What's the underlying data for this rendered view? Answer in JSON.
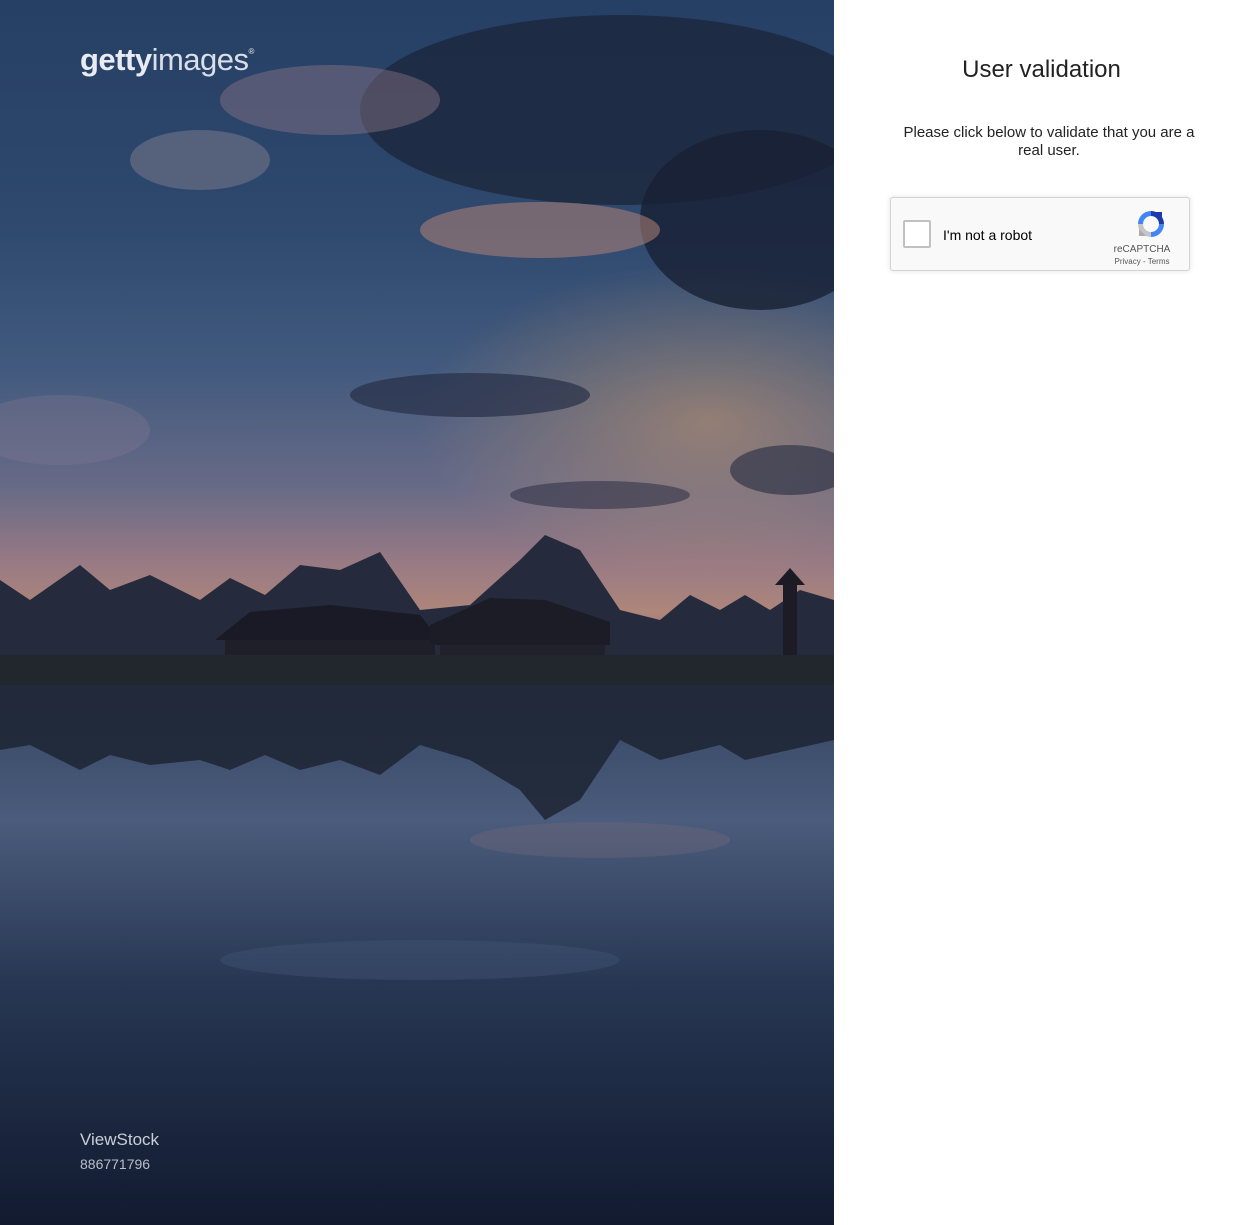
{
  "hero": {
    "logo_bold": "getty",
    "logo_light": "images",
    "logo_mark": "®",
    "artist": "ViewStock",
    "asset_id": "886771796"
  },
  "validation": {
    "title": "User validation",
    "description": "Please click below to validate that you are a real user."
  },
  "recaptcha": {
    "checkbox_label": "I'm not a robot",
    "brand": "reCAPTCHA",
    "privacy_link": "Privacy",
    "separator": " - ",
    "terms_link": "Terms",
    "checked": false
  }
}
